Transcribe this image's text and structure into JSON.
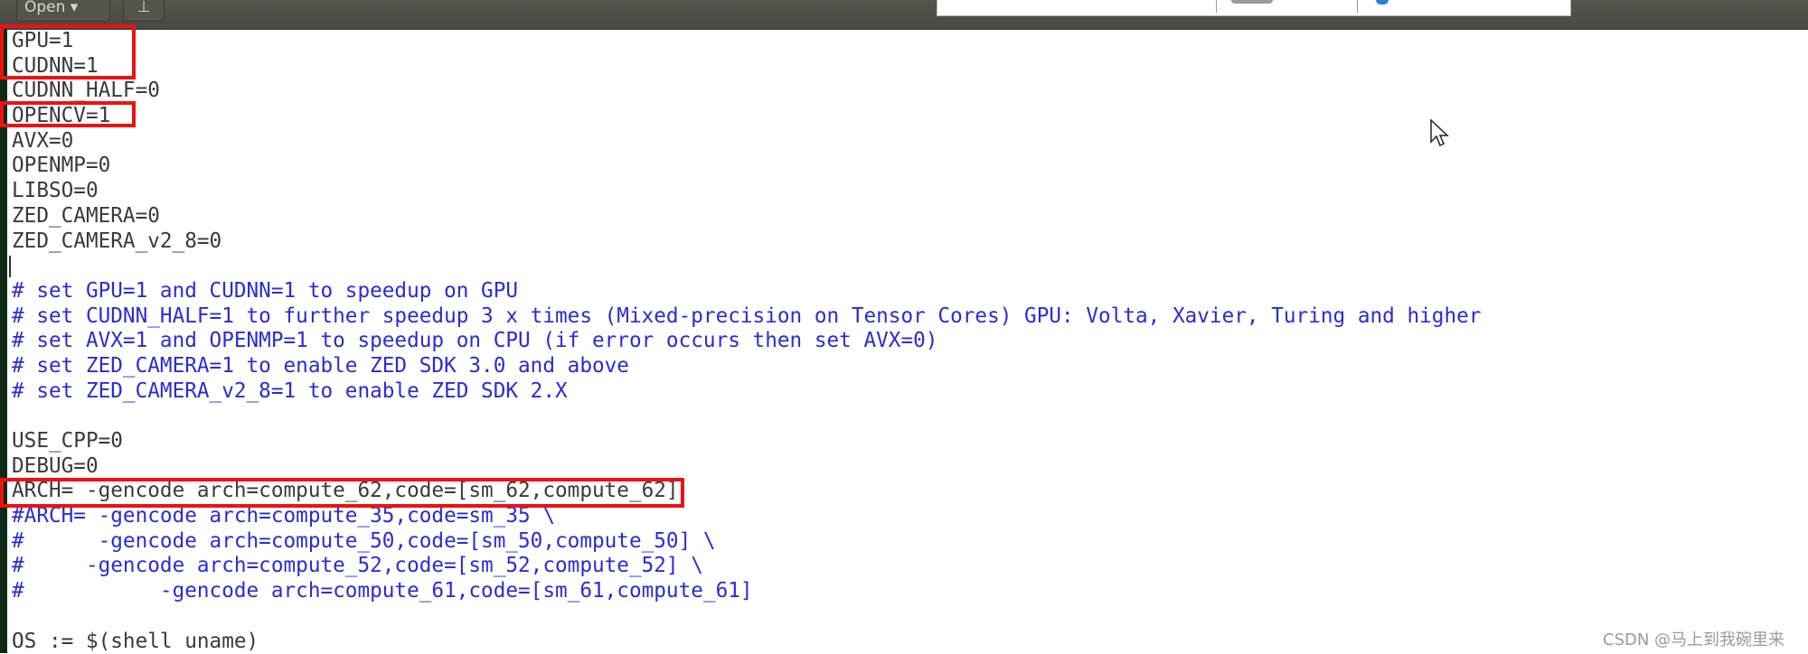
{
  "toolbar": {
    "open_label": "Open ▾",
    "pin_icon": "pin-icon"
  },
  "editor": {
    "lines": [
      {
        "text": "GPU=1",
        "type": "code"
      },
      {
        "text": "CUDNN=1",
        "type": "code"
      },
      {
        "text": "CUDNN_HALF=0",
        "type": "code"
      },
      {
        "text": "OPENCV=1",
        "type": "code"
      },
      {
        "text": "AVX=0",
        "type": "code"
      },
      {
        "text": "OPENMP=0",
        "type": "code"
      },
      {
        "text": "LIBSO=0",
        "type": "code"
      },
      {
        "text": "ZED_CAMERA=0",
        "type": "code"
      },
      {
        "text": "ZED_CAMERA_v2_8=0",
        "type": "code"
      },
      {
        "text": "",
        "type": "code"
      },
      {
        "text": "# set GPU=1 and CUDNN=1 to speedup on GPU",
        "type": "comment"
      },
      {
        "text": "# set CUDNN_HALF=1 to further speedup 3 x times (Mixed-precision on Tensor Cores) GPU: Volta, Xavier, Turing and higher",
        "type": "comment"
      },
      {
        "text": "# set AVX=1 and OPENMP=1 to speedup on CPU (if error occurs then set AVX=0)",
        "type": "comment"
      },
      {
        "text": "# set ZED_CAMERA=1 to enable ZED SDK 3.0 and above",
        "type": "comment"
      },
      {
        "text": "# set ZED_CAMERA_v2_8=1 to enable ZED SDK 2.X",
        "type": "comment"
      },
      {
        "text": "",
        "type": "code"
      },
      {
        "text": "USE_CPP=0",
        "type": "code"
      },
      {
        "text": "DEBUG=0",
        "type": "code"
      },
      {
        "text": "ARCH= -gencode arch=compute_62,code=[sm_62,compute_62]",
        "type": "code"
      },
      {
        "text": "#ARCH= -gencode arch=compute_35,code=sm_35 \\",
        "type": "comment"
      },
      {
        "text": "#      -gencode arch=compute_50,code=[sm_50,compute_50] \\",
        "type": "comment"
      },
      {
        "text": "#     -gencode arch=compute_52,code=[sm_52,compute_52] \\",
        "type": "comment"
      },
      {
        "text": "#           -gencode arch=compute_61,code=[sm_61,compute_61]",
        "type": "comment"
      },
      {
        "text": "",
        "type": "code"
      },
      {
        "text": "OS := $(shell uname)",
        "type": "code"
      }
    ]
  },
  "colors": {
    "highlight_box": "#ee1111",
    "comment": "#2b2bd6",
    "code": "#3a3a3a",
    "toolbar": "#4d4b45"
  },
  "watermark": "CSDN @马上到我碗里来"
}
